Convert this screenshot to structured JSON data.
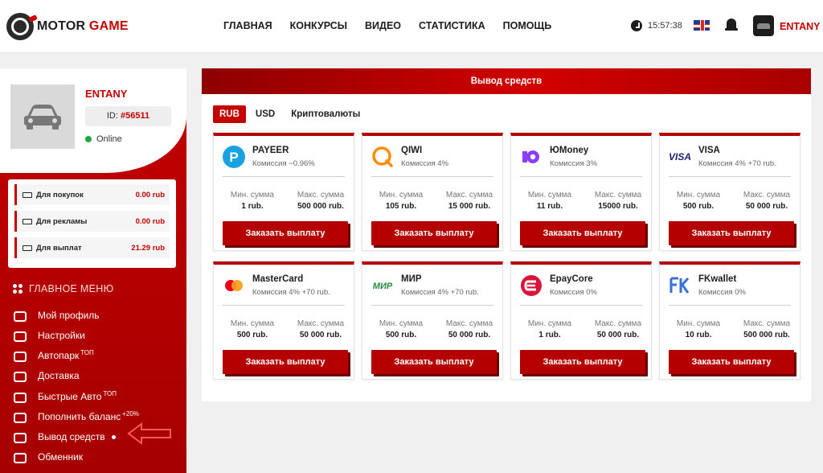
{
  "header": {
    "logo_motor": "MOTOR",
    "logo_game": "GAME",
    "nav": [
      "ГЛАВНАЯ",
      "КОНКУРСЫ",
      "ВИДЕО",
      "СТАТИСТИКА",
      "ПОМОЩЬ"
    ],
    "time": "15:57:38",
    "username": "ENTANY"
  },
  "profile": {
    "name": "ENTANY",
    "id_label": "ID:",
    "id_value": "#56511",
    "status": "Online",
    "status_color": "#22a83a"
  },
  "balances": [
    {
      "label": "Для покупок",
      "value": "0.00 rub",
      "icon": "cart-icon"
    },
    {
      "label": "Для рекламы",
      "value": "0.00 rub",
      "icon": "megaphone-icon"
    },
    {
      "label": "Для выплат",
      "value": "21.29 rub",
      "icon": "money-icon"
    }
  ],
  "menu": {
    "title": "ГЛАВНОЕ МЕНЮ",
    "items": [
      {
        "label": "Мой профиль",
        "sup": "",
        "icon": "profile-car-icon"
      },
      {
        "label": "Настройки",
        "sup": "",
        "icon": "settings-icon"
      },
      {
        "label": "Автопарк",
        "sup": "ТОП",
        "icon": "key-icon"
      },
      {
        "label": "Доставка",
        "sup": "",
        "icon": "truck-icon"
      },
      {
        "label": "Быстрые Авто",
        "sup": "ТОП",
        "icon": "fast-car-icon"
      },
      {
        "label": "Пополнить баланс",
        "sup": "+20%",
        "icon": "piggy-bank-icon"
      },
      {
        "label": "Вывод средств",
        "sup": "",
        "icon": "withdraw-icon",
        "active": true
      },
      {
        "label": "Обменник",
        "sup": "",
        "icon": "exchange-icon"
      }
    ]
  },
  "panel": {
    "title": "Вывод средств",
    "tabs": [
      "RUB",
      "USD",
      "Криптовалюты"
    ],
    "active_tab": "RUB",
    "min_label": "Мин. сумма",
    "max_label": "Макс. сумма",
    "button_label": "Заказать выплату",
    "methods": [
      {
        "name": "PAYEER",
        "fee": "Комиссия ~0.96%",
        "min": "1 rub.",
        "max": "500 000 rub.",
        "icon": "payeer-icon"
      },
      {
        "name": "QIWI",
        "fee": "Комиссия 4%",
        "min": "105 rub.",
        "max": "15 000 rub.",
        "icon": "qiwi-icon"
      },
      {
        "name": "ЮMoney",
        "fee": "Комиссия 3%",
        "min": "11 rub.",
        "max": "15000 rub.",
        "icon": "yoomoney-icon"
      },
      {
        "name": "VISA",
        "fee": "Комиссия 4% +70 rub.",
        "min": "500 rub.",
        "max": "50 000 rub.",
        "icon": "visa-icon"
      },
      {
        "name": "MasterCard",
        "fee": "Комиссия 4% +70 rub.",
        "min": "500 rub.",
        "max": "50 000 rub.",
        "icon": "mastercard-icon"
      },
      {
        "name": "МИР",
        "fee": "Комиссия 4% +70 rub.",
        "min": "500 rub.",
        "max": "50 000 rub.",
        "icon": "mir-icon"
      },
      {
        "name": "EpayCore",
        "fee": "Комиссия 0%",
        "min": "1 rub.",
        "max": "50 000 rub.",
        "icon": "epaycore-icon"
      },
      {
        "name": "FKwallet",
        "fee": "Комиссия 0%",
        "min": "10 rub.",
        "max": "500 000 rub.",
        "icon": "fkwallet-icon"
      }
    ]
  },
  "colors": {
    "brand_red": "#c40000",
    "dark": "#1d1d1d"
  }
}
